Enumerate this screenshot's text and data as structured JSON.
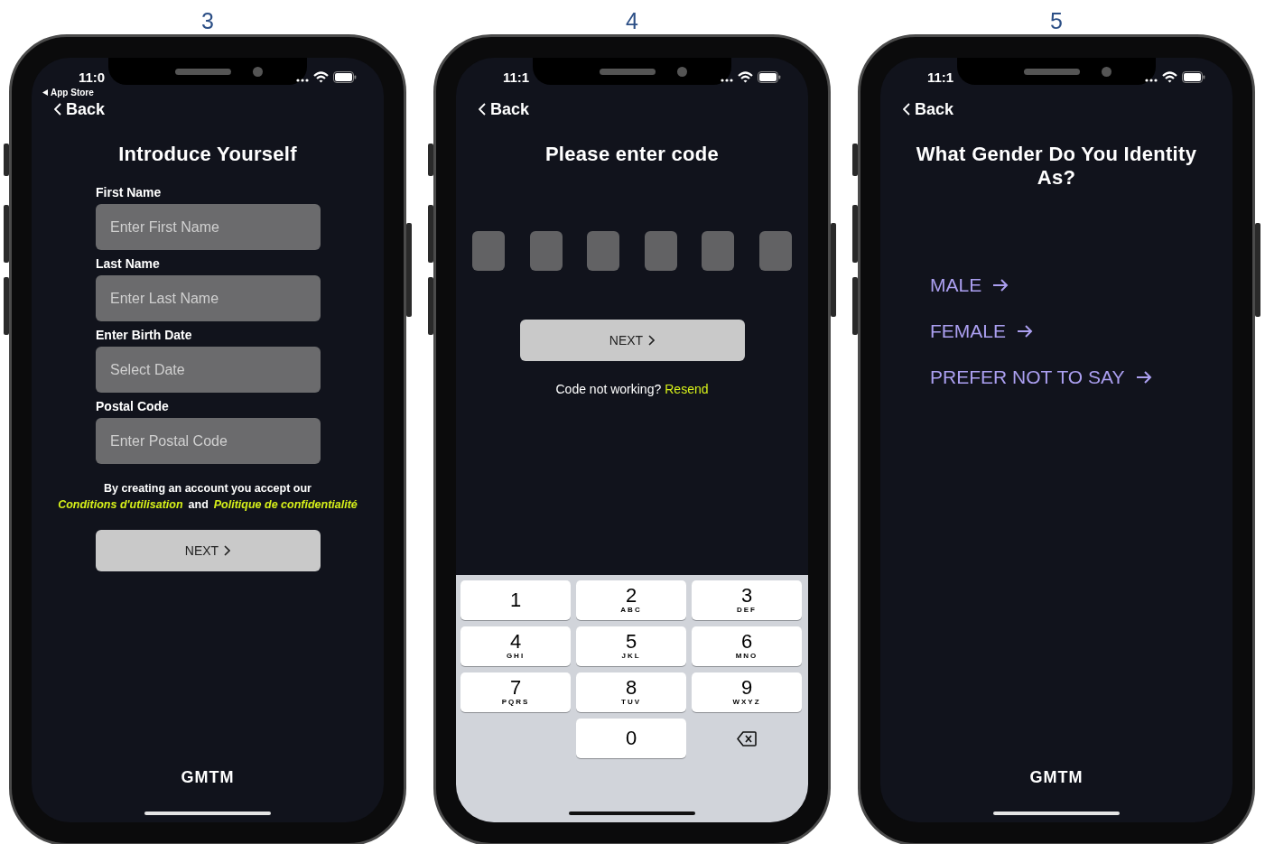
{
  "screens": [
    {
      "number": "3",
      "kind": "form",
      "status": {
        "time": "11:0",
        "return_link": "App Store"
      },
      "back": "Back",
      "title": "Introduce Yourself",
      "fields": [
        {
          "label": "First Name",
          "placeholder": "Enter First Name"
        },
        {
          "label": "Last Name",
          "placeholder": "Enter Last Name"
        },
        {
          "label": "Enter Birth Date",
          "placeholder": "Select Date"
        },
        {
          "label": "Postal Code",
          "placeholder": "Enter Postal Code"
        }
      ],
      "terms": {
        "text": "By creating an account you accept our",
        "link_1": "Conditions d'utilisation",
        "joiner": "and",
        "link_2": "Politique de confidentialité"
      },
      "button": "NEXT",
      "logo": "GMTM"
    },
    {
      "number": "4",
      "kind": "code",
      "status": {
        "time": "11:1"
      },
      "back": "Back",
      "title": "Please enter code",
      "code_boxes": [
        {
          "filled": false
        },
        {
          "filled": false
        },
        {
          "filled": false
        },
        {
          "filled": false
        },
        {
          "filled": false
        },
        {
          "filled": false
        }
      ],
      "button": "NEXT",
      "help": {
        "text": "Code not working?",
        "link": "Resend"
      },
      "keypad": [
        {
          "kind": "digit",
          "digit": "1"
        },
        {
          "kind": "digit",
          "digit": "2",
          "letters": "ABC"
        },
        {
          "kind": "digit",
          "digit": "3",
          "letters": "DEF"
        },
        {
          "kind": "digit",
          "digit": "4",
          "letters": "GHI"
        },
        {
          "kind": "digit",
          "digit": "5",
          "letters": "JKL"
        },
        {
          "kind": "digit",
          "digit": "6",
          "letters": "MNO"
        },
        {
          "kind": "digit",
          "digit": "7",
          "letters": "PQRS"
        },
        {
          "kind": "digit",
          "digit": "8",
          "letters": "TUV"
        },
        {
          "kind": "digit",
          "digit": "9",
          "letters": "WXYZ"
        },
        {
          "kind": "blank"
        },
        {
          "kind": "digit",
          "digit": "0"
        },
        {
          "kind": "delete"
        }
      ]
    },
    {
      "number": "5",
      "kind": "choice",
      "status": {
        "time": "11:1"
      },
      "back": "Back",
      "title": "What Gender Do You Identity As?",
      "options": [
        {
          "label": "MALE"
        },
        {
          "label": "FEMALE"
        },
        {
          "label": "PREFER NOT TO SAY"
        }
      ],
      "logo": "GMTM"
    }
  ]
}
